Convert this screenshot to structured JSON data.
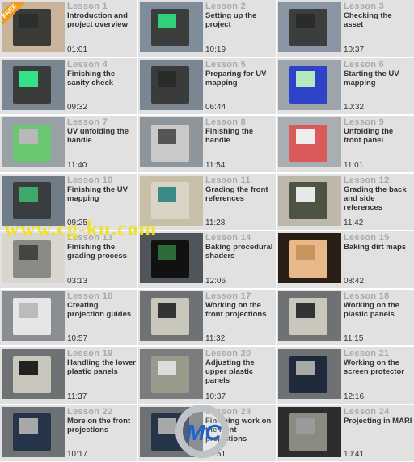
{
  "free_badge": "FREE",
  "watermark": {
    "site": "www.cg-ku.com",
    "logo": "MC"
  },
  "lessons": [
    {
      "label": "Lesson 1",
      "title": "Introduction and project overview",
      "duration": "01:01",
      "thumb": [
        "#c9b39a",
        "#3a3a36",
        "#2b2f2e"
      ]
    },
    {
      "label": "Lesson 2",
      "title": "Setting up the project",
      "duration": "10:19",
      "thumb": [
        "#7f8c99",
        "#3b3d3d",
        "#32d07a"
      ]
    },
    {
      "label": "Lesson 3",
      "title": "Checking the asset",
      "duration": "10:37",
      "thumb": [
        "#8a96a3",
        "#3c3e3e",
        "#2a2c2c"
      ]
    },
    {
      "label": "Lesson 4",
      "title": "Finishing the sanity check",
      "duration": "09:32",
      "thumb": [
        "#7a8793",
        "#3a3c3c",
        "#35e28a"
      ]
    },
    {
      "label": "Lesson 5",
      "title": "Preparing for UV mapping",
      "duration": "06:44",
      "thumb": [
        "#7a8793",
        "#3a3c3c",
        "#2a2c2c"
      ]
    },
    {
      "label": "Lesson 6",
      "title": "Starting the UV mapping",
      "duration": "10:32",
      "thumb": [
        "#9da4aa",
        "#2e43c8",
        "#b4e8c0"
      ]
    },
    {
      "label": "Lesson 7",
      "title": "UV unfolding the handle",
      "duration": "11:40",
      "thumb": [
        "#9aa1a6",
        "#68c770",
        "#b8b8b8"
      ]
    },
    {
      "label": "Lesson 8",
      "title": "Finishing the handle",
      "duration": "11:54",
      "thumb": [
        "#8e969c",
        "#c9c9c9",
        "#555"
      ]
    },
    {
      "label": "Lesson 9",
      "title": "Unfolding the front panel",
      "duration": "11:01",
      "thumb": [
        "#a8aeb2",
        "#d85a5a",
        "#eee"
      ]
    },
    {
      "label": "Lesson 10",
      "title": "Finishing the UV mapping",
      "duration": "09:25",
      "thumb": [
        "#707d88",
        "#3a3d3d",
        "#3fa86a"
      ]
    },
    {
      "label": "Lesson 11",
      "title": "Grading the front references",
      "duration": "11:28",
      "thumb": [
        "#c8bfa8",
        "#d9d4c6",
        "#3a8a86"
      ]
    },
    {
      "label": "Lesson 12",
      "title": "Grading the back and side references",
      "duration": "11:42",
      "thumb": [
        "#bdb8a9",
        "#4e5443",
        "#e8e8e8"
      ]
    },
    {
      "label": "Lesson 13",
      "title": "Finishing the grading process",
      "duration": "03:13",
      "thumb": [
        "#d8d6cf",
        "#8a8a84",
        "#444"
      ]
    },
    {
      "label": "Lesson 14",
      "title": "Baking procedural shaders",
      "duration": "12:06",
      "thumb": [
        "#4f555a",
        "#111",
        "#2c6a3a"
      ]
    },
    {
      "label": "Lesson 15",
      "title": "Baking dirt maps",
      "duration": "08:42",
      "thumb": [
        "#2a1f17",
        "#e7b88a",
        "#c9935e"
      ]
    },
    {
      "label": "Lesson 16",
      "title": "Creating projection guides",
      "duration": "10:57",
      "thumb": [
        "#8a8e92",
        "#e6e6e6",
        "#bbb"
      ]
    },
    {
      "label": "Lesson 17",
      "title": "Working on the front projections",
      "duration": "11:32",
      "thumb": [
        "#6f7275",
        "#c9c6bc",
        "#333"
      ]
    },
    {
      "label": "Lesson 18",
      "title": "Working on the plastic panels",
      "duration": "11:15",
      "thumb": [
        "#6f7275",
        "#c9c6bc",
        "#333"
      ]
    },
    {
      "label": "Lesson 19",
      "title": "Handling the lower plastic panels",
      "duration": "11:37",
      "thumb": [
        "#6f7275",
        "#c9c6bc",
        "#222"
      ]
    },
    {
      "label": "Lesson 20",
      "title": "Adjusting the upper plastic panels",
      "duration": "10:37",
      "thumb": [
        "#7a7c7d",
        "#9a9a8c",
        "#ddd"
      ]
    },
    {
      "label": "Lesson 21",
      "title": "Working on the screen protector",
      "duration": "12:16",
      "thumb": [
        "#6f7275",
        "#1f2a3b",
        "#a8a8a8"
      ]
    },
    {
      "label": "Lesson 22",
      "title": "More on the front projections",
      "duration": "10:17",
      "thumb": [
        "#6f7275",
        "#26344a",
        "#a8a8a8"
      ]
    },
    {
      "label": "Lesson 23",
      "title": "Finishing work on the front projections",
      "duration": "10:51",
      "thumb": [
        "#6f7275",
        "#26344a",
        "#a8a8a8"
      ]
    },
    {
      "label": "Lesson 24",
      "title": "Projecting in MARI",
      "duration": "10:41",
      "thumb": [
        "#2d2d2d",
        "#8a8a80",
        "#9a9a9a"
      ]
    }
  ]
}
